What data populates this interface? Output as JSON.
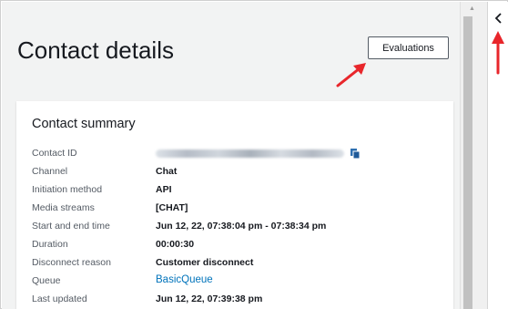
{
  "page": {
    "title": "Contact details",
    "evaluations_button": "Evaluations"
  },
  "summary": {
    "title": "Contact summary",
    "rows": [
      {
        "label": "Contact ID",
        "value": ""
      },
      {
        "label": "Channel",
        "value": "Chat"
      },
      {
        "label": "Initiation method",
        "value": "API"
      },
      {
        "label": "Media streams",
        "value": "[CHAT]"
      },
      {
        "label": "Start and end time",
        "value": "Jun 12, 22, 07:38:04 pm - 07:38:34 pm"
      },
      {
        "label": "Duration",
        "value": "00:00:30"
      },
      {
        "label": "Disconnect reason",
        "value": "Customer disconnect"
      },
      {
        "label": "Queue",
        "value": "BasicQueue"
      },
      {
        "label": "Last updated",
        "value": "Jun 12, 22, 07:39:38 pm"
      }
    ]
  },
  "icons": {
    "copy": "copy-icon",
    "collapse": "chevron-left-icon",
    "annotation": "red-arrow-icon",
    "scroll_up": "scroll-up-icon"
  },
  "colors": {
    "link": "#0073bb",
    "annotation_arrow": "#e8262b",
    "background": "#f2f3f3"
  }
}
